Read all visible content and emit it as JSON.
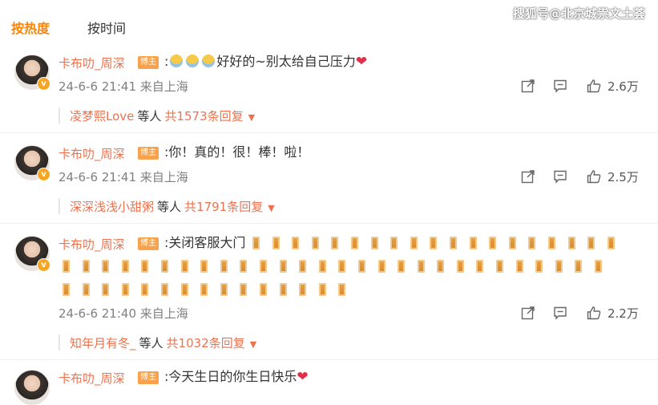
{
  "sort_tabs": {
    "hot": "按热度",
    "time": "按时间"
  },
  "watermark": "搜狐号@北京城祟文土荟",
  "avatar_badge": "v",
  "blogger_badge": "博主",
  "heart": "❤",
  "caret": "▼",
  "comments": [
    {
      "username": "卡布叻_周深",
      "prefix": ":",
      "text": "好好的~别太给自己压力",
      "time": "24-6-6 21:41",
      "location": "来自上海",
      "likes": "2.6万",
      "reply_user": "凌梦熙Love",
      "reply_etc": "等人",
      "reply_count": "共1573条回复"
    },
    {
      "username": "卡布叻_周深",
      "text": ":你！真的！很！棒！啦！",
      "time": "24-6-6 21:41",
      "location": "来自上海",
      "likes": "2.5万",
      "reply_user": "深深浅浅小甜粥",
      "reply_etc": "等人",
      "reply_count": "共1791条回复"
    },
    {
      "username": "卡布叻_周深",
      "text": ":关闭客服大门",
      "time": "24-6-6 21:40",
      "location": "来自上海",
      "likes": "2.2万",
      "reply_user": "知年月有冬_",
      "reply_etc": "等人",
      "reply_count": "共1032条回复"
    },
    {
      "username": "卡布叻_周深",
      "text": ":今天生日的你生日快乐"
    }
  ]
}
